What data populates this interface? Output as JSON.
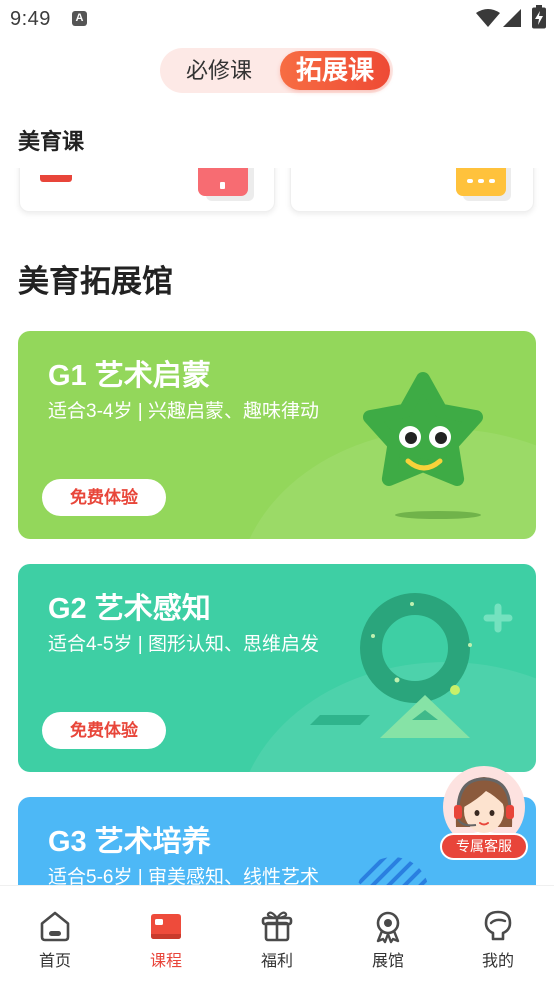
{
  "status_bar": {
    "time": "9:49",
    "notification_glyph": "A",
    "icons": [
      "wifi-icon",
      "signal-icon",
      "battery-charging-icon"
    ]
  },
  "segment": {
    "tabs": [
      {
        "label": "必修课",
        "active": false
      },
      {
        "label": "拓展课",
        "active": true
      }
    ]
  },
  "aesthetic_section": {
    "title": "美育课",
    "cards": [
      {
        "icon": "pink-card-icon"
      },
      {
        "icon": "yellow-card-icon"
      }
    ]
  },
  "hall": {
    "title": "美育拓展馆",
    "courses": [
      {
        "title": "G1 艺术启蒙",
        "subtitle": "适合3-4岁 | 兴趣启蒙、趣味律动",
        "button": "免费体验",
        "color": "#93d75b",
        "illustration": "star-mascot-icon"
      },
      {
        "title": "G2 艺术感知",
        "subtitle": "适合4-5岁 | 图形认知、思维启发",
        "button": "免费体验",
        "color": "#3ecfa4",
        "illustration": "ring-shapes-icon"
      },
      {
        "title": "G3 艺术培养",
        "subtitle": "适合5-6岁 | 审美感知、线性艺术",
        "color": "#4db8f6",
        "illustration": "stripes-icon"
      }
    ]
  },
  "service": {
    "label": "专属客服",
    "icon": "customer-service-avatar-icon"
  },
  "bottom_nav": {
    "items": [
      {
        "label": "首页",
        "icon": "home-icon",
        "active": false
      },
      {
        "label": "课程",
        "icon": "course-icon",
        "active": true
      },
      {
        "label": "福利",
        "icon": "gift-icon",
        "active": false
      },
      {
        "label": "展馆",
        "icon": "medal-icon",
        "active": false
      },
      {
        "label": "我的",
        "icon": "profile-icon",
        "active": false
      }
    ]
  },
  "colors": {
    "accent": "#ee4a35",
    "toggle_bg": "#fde9e6",
    "nav_active": "#e8453a"
  }
}
